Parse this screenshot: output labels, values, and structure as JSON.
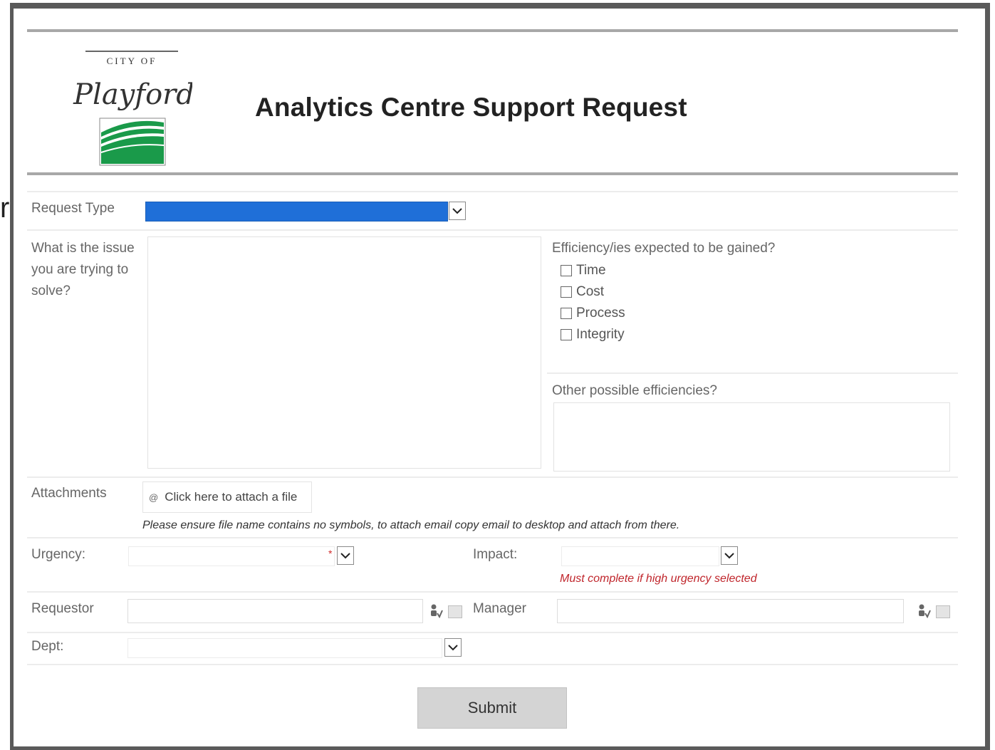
{
  "header": {
    "title": "Analytics Centre Support Request",
    "logo_text_top": "CITY OF",
    "logo_script": "Playford"
  },
  "stray_text": "r",
  "fields": {
    "request_type": {
      "label": "Request Type",
      "value": ""
    },
    "issue": {
      "label": "What is the issue you are trying to solve?",
      "value": ""
    },
    "efficiency": {
      "label": "Efficiency/ies expected to be gained?",
      "options": [
        "Time",
        "Cost",
        "Process",
        "Integrity"
      ]
    },
    "other_efficiencies": {
      "label": "Other possible efficiencies?",
      "value": ""
    },
    "attachments": {
      "label": "Attachments",
      "button_text": "Click here to attach a file",
      "note": "Please ensure file name contains no symbols, to attach email copy email to desktop and attach from there."
    },
    "urgency": {
      "label": "Urgency:",
      "required_marker": "*"
    },
    "impact": {
      "label": "Impact:",
      "note": "Must complete if high urgency selected"
    },
    "requestor": {
      "label": "Requestor",
      "value": ""
    },
    "manager": {
      "label": "Manager",
      "value": ""
    },
    "dept": {
      "label": "Dept:",
      "value": ""
    }
  },
  "submit_label": "Submit",
  "colors": {
    "selection_blue": "#1f6fd8",
    "required_red": "#c0262c",
    "logo_green": "#1a9a4a"
  }
}
